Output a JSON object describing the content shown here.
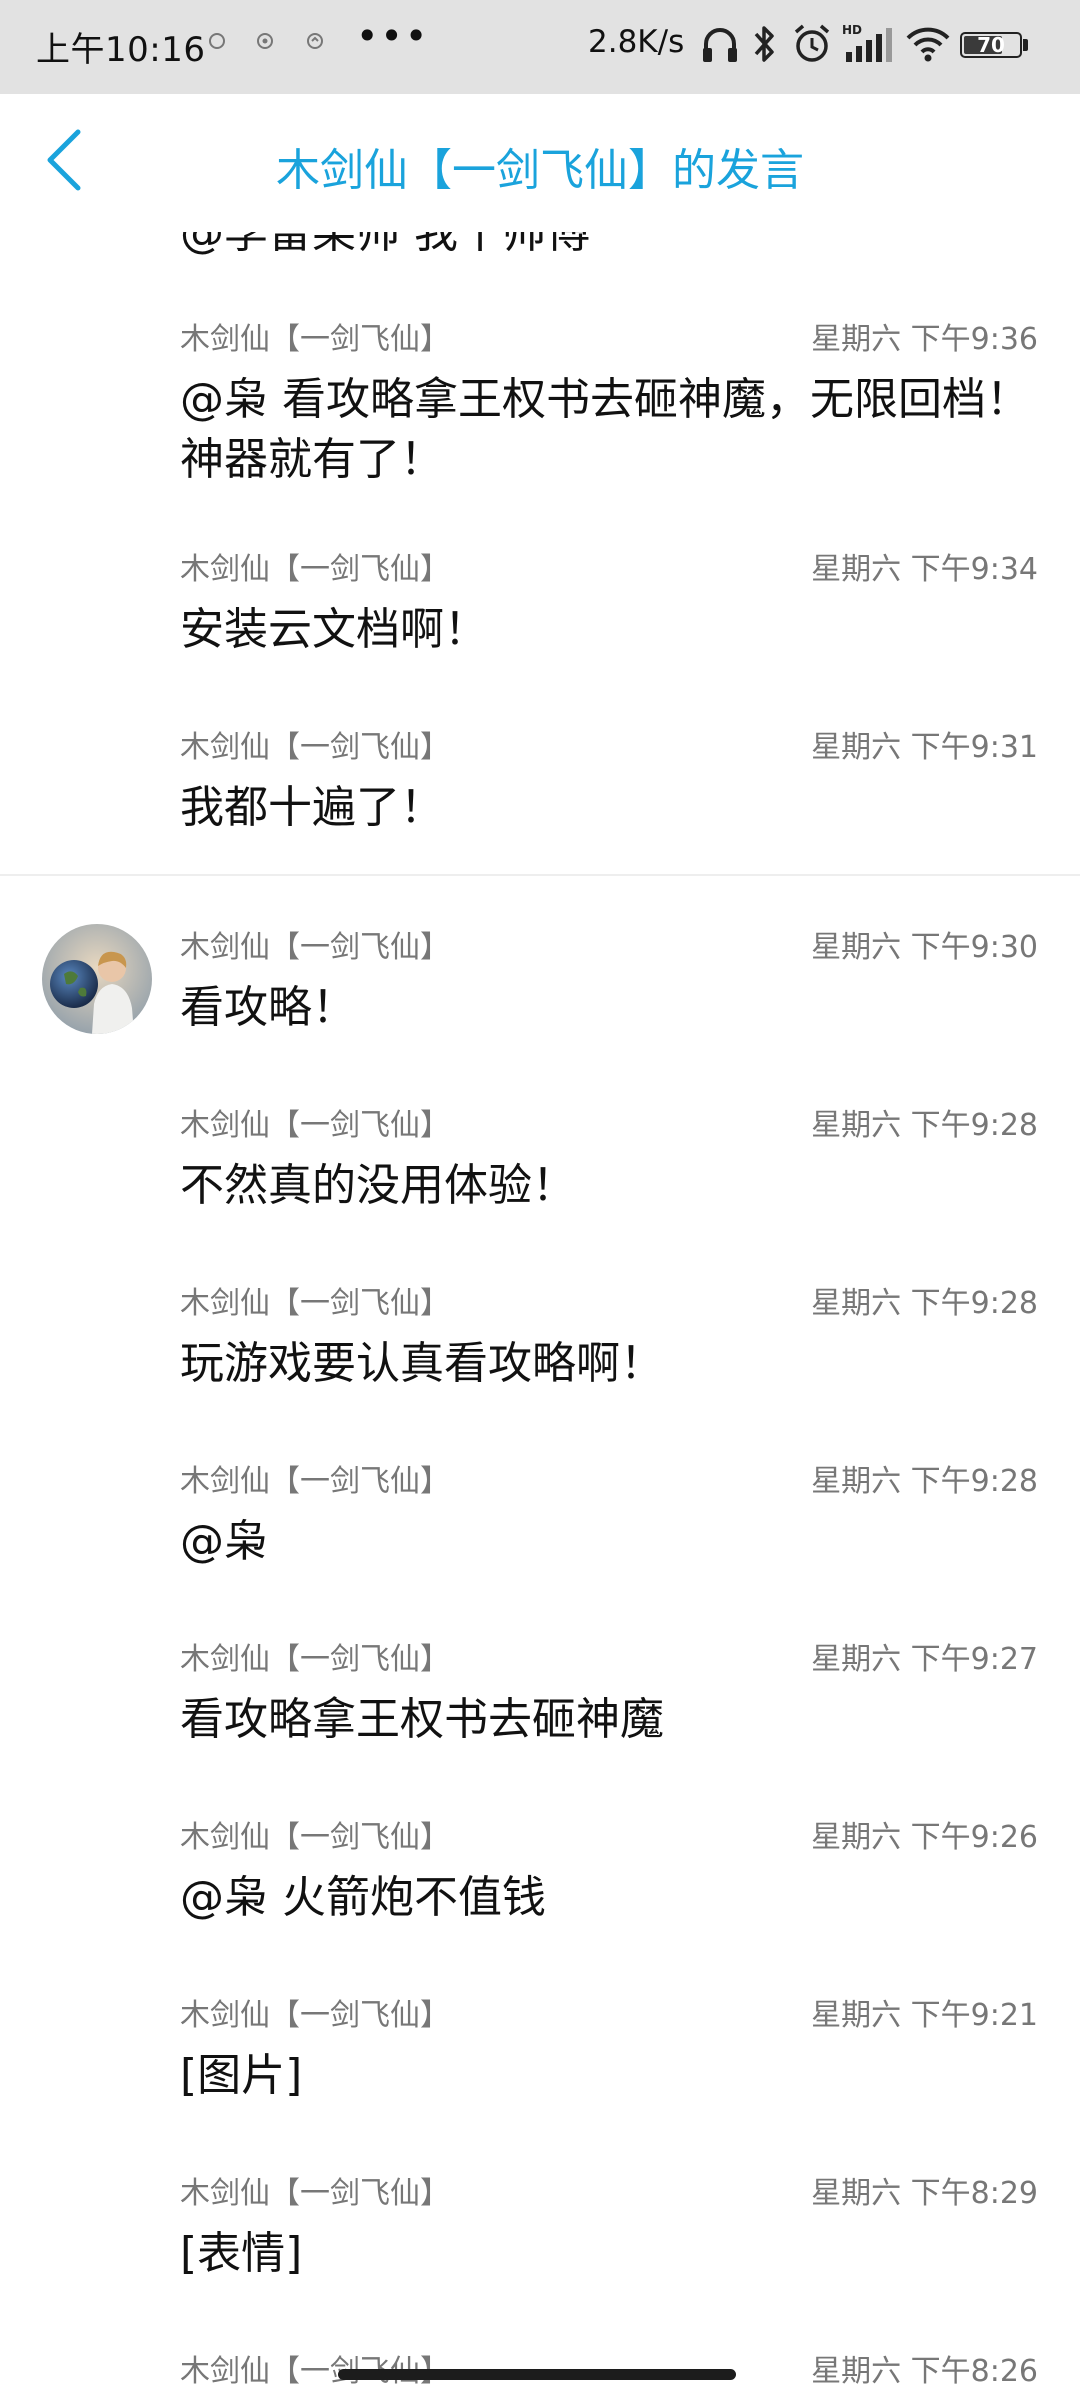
{
  "status_bar": {
    "time": "上午10:16",
    "dots": "•••",
    "net_speed": "2.8K/s",
    "battery": "70",
    "battery_level": 0.7,
    "icons": [
      "notification-icon",
      "notification-icon",
      "notification-icon",
      "headphones-icon",
      "bluetooth-icon",
      "alarm-icon",
      "hd-signal-icon",
      "wifi-icon",
      "battery-icon"
    ]
  },
  "header": {
    "title": "木剑仙【一剑飞仙】的发言",
    "back_icon": "chevron-left-icon",
    "accent_color": "#1aa3dc"
  },
  "cut_message": "@李雷某帅 我十帅傅",
  "messages": [
    {
      "name": "木剑仙【一剑飞仙】",
      "time": "星期六 下午9:36",
      "text": "@枭 看攻略拿王权书去砸神魔，无限回档！神器就有了！"
    },
    {
      "name": "木剑仙【一剑飞仙】",
      "time": "星期六 下午9:34",
      "text": "安装云文档啊！"
    },
    {
      "name": "木剑仙【一剑飞仙】",
      "time": "星期六 下午9:31",
      "text": "我都十遍了！"
    },
    {
      "name": "木剑仙【一剑飞仙】",
      "time": "星期六 下午9:30",
      "text": "看攻略！"
    },
    {
      "name": "木剑仙【一剑飞仙】",
      "time": "星期六 下午9:28",
      "text": "不然真的没用体验！"
    },
    {
      "name": "木剑仙【一剑飞仙】",
      "time": "星期六 下午9:28",
      "text": "玩游戏要认真看攻略啊！"
    },
    {
      "name": "木剑仙【一剑飞仙】",
      "time": "星期六 下午9:28",
      "text": "@枭"
    },
    {
      "name": "木剑仙【一剑飞仙】",
      "time": "星期六 下午9:27",
      "text": "看攻略拿王权书去砸神魔"
    },
    {
      "name": "木剑仙【一剑飞仙】",
      "time": "星期六 下午9:26",
      "text": "@枭 火箭炮不值钱"
    },
    {
      "name": "木剑仙【一剑飞仙】",
      "time": "星期六 下午9:21",
      "text": "[图片]"
    },
    {
      "name": "木剑仙【一剑飞仙】",
      "time": "星期六 下午8:29",
      "text": "[表情]"
    },
    {
      "name": "木剑仙【一剑飞仙】",
      "time": "星期六 下午8:26",
      "text": ""
    }
  ]
}
